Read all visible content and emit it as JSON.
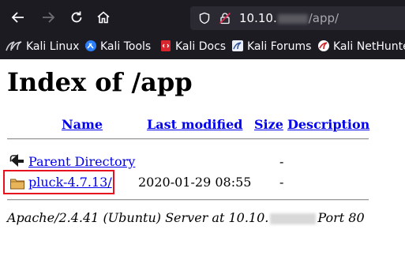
{
  "browser": {
    "url_host": "10.10.",
    "url_path": "/app/",
    "bookmarks": [
      {
        "label": "Kali Linux",
        "icon": "kali-dragon-icon"
      },
      {
        "label": "Kali Tools",
        "icon": "kali-tools-icon"
      },
      {
        "label": "Kali Docs",
        "icon": "kali-docs-icon"
      },
      {
        "label": "Kali Forums",
        "icon": "kali-forums-icon"
      },
      {
        "label": "Kali NetHunter",
        "icon": "kali-nethunter-icon"
      }
    ]
  },
  "page": {
    "title": "Index of /app",
    "columns": {
      "name": "Name",
      "last_modified": "Last modified",
      "size": "Size",
      "description": "Description"
    },
    "rows": [
      {
        "name": "Parent Directory",
        "modified": "",
        "size": "-",
        "icon": "back-arrow-icon"
      },
      {
        "name": "pluck-4.7.13/",
        "modified": "2020-01-29 08:55",
        "size": "-",
        "icon": "folder-icon"
      }
    ],
    "footer_prefix": "Apache/2.4.41 (Ubuntu) Server at 10.10.",
    "footer_suffix": "Port 80"
  },
  "colors": {
    "chrome_bg": "#1c1b22",
    "link": "#0000ee",
    "highlight": "#e8101e"
  }
}
